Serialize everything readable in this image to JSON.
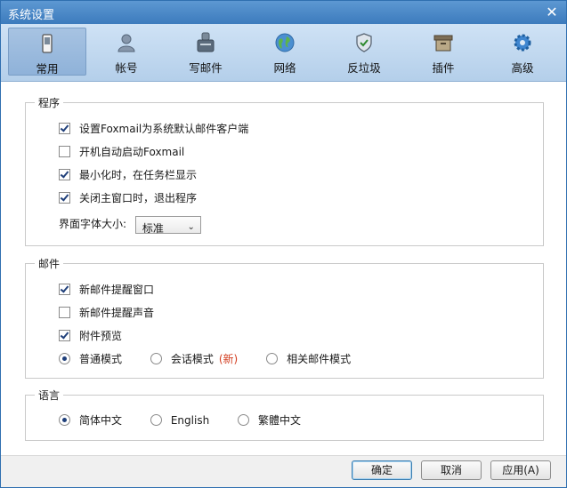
{
  "window": {
    "title": "系统设置",
    "close_glyph": "✕"
  },
  "toolbar": {
    "tabs": [
      {
        "label": "常用",
        "icon": "phone-icon",
        "active": true
      },
      {
        "label": "帐号",
        "icon": "user-icon"
      },
      {
        "label": "写邮件",
        "icon": "compose-icon"
      },
      {
        "label": "网络",
        "icon": "globe-icon"
      },
      {
        "label": "反垃圾",
        "icon": "shield-icon"
      },
      {
        "label": "插件",
        "icon": "box-icon"
      },
      {
        "label": "高级",
        "icon": "gear-icon"
      }
    ]
  },
  "program": {
    "legend": "程序",
    "items": [
      {
        "label": "设置Foxmail为系统默认邮件客户端",
        "checked": true
      },
      {
        "label": "开机自动启动Foxmail",
        "checked": false
      },
      {
        "label": "最小化时，在任务栏显示",
        "checked": true
      },
      {
        "label": "关闭主窗口时，退出程序",
        "checked": true
      }
    ],
    "font_size_label": "界面字体大小:",
    "font_size_value": "标准"
  },
  "mail": {
    "legend": "邮件",
    "items": [
      {
        "label": "新邮件提醒窗口",
        "checked": true
      },
      {
        "label": "新邮件提醒声音",
        "checked": false
      },
      {
        "label": "附件预览",
        "checked": true
      }
    ],
    "modes": [
      {
        "label": "普通模式",
        "selected": true
      },
      {
        "label": "会话模式",
        "tag": "(新)",
        "selected": false
      },
      {
        "label": "相关邮件模式",
        "selected": false
      }
    ]
  },
  "language": {
    "legend": "语言",
    "options": [
      {
        "label": "简体中文",
        "selected": true
      },
      {
        "label": "English",
        "selected": false
      },
      {
        "label": "繁體中文",
        "selected": false
      }
    ]
  },
  "footer": {
    "ok": "确定",
    "cancel": "取消",
    "apply": "应用(A)"
  },
  "colors": {
    "titlebar": "#4a87c6",
    "toolbar": "#c2d9f0",
    "check": "#1f3f7a",
    "new_tag": "#d23c1e"
  }
}
